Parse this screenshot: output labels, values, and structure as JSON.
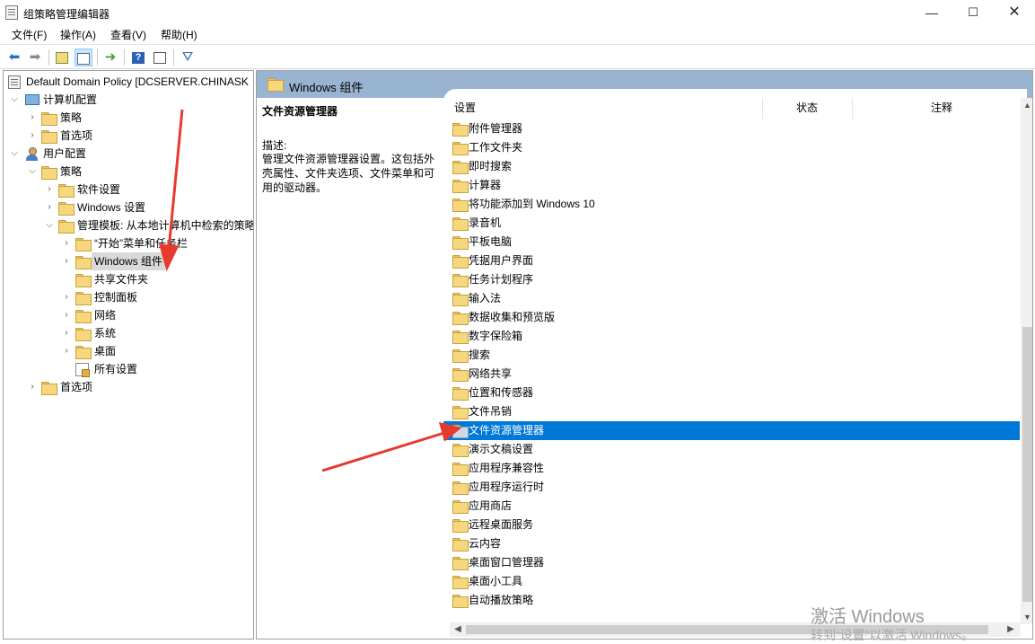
{
  "window": {
    "title": "组策略管理编辑器"
  },
  "menu": [
    "文件(F)",
    "操作(A)",
    "查看(V)",
    "帮助(H)"
  ],
  "tree": {
    "root": "Default Domain Policy [DCSERVER.CHINASK",
    "computer_config": "计算机配置",
    "cc_policies": "策略",
    "cc_preferences": "首选项",
    "user_config": "用户配置",
    "uc_policies": "策略",
    "software_settings": "软件设置",
    "windows_settings": "Windows 设置",
    "admin_templates": "管理模板: 从本地计算机中检索的策略",
    "start_menu": "“开始”菜单和任务栏",
    "windows_components": "Windows 组件",
    "shared_folders": "共享文件夹",
    "control_panel": "控制面板",
    "network": "网络",
    "system": "系统",
    "desktop": "桌面",
    "all_settings": "所有设置",
    "uc_preferences": "首选项"
  },
  "right": {
    "header_title": "Windows 组件",
    "desc_title": "文件资源管理器",
    "desc_label": "描述:",
    "desc_text": "管理文件资源管理器设置。这包括外壳属性、文件夹选项、文件菜单和可用的驱动器。",
    "columns": {
      "setting": "设置",
      "state": "状态",
      "comment": "注释"
    },
    "items": [
      "附件管理器",
      "工作文件夹",
      "即时搜索",
      "计算器",
      "将功能添加到 Windows 10",
      "录音机",
      "平板电脑",
      "凭据用户界面",
      "任务计划程序",
      "输入法",
      "数据收集和预览版",
      "数字保险箱",
      "搜索",
      "网络共享",
      "位置和传感器",
      "文件吊销",
      "文件资源管理器",
      "演示文稿设置",
      "应用程序兼容性",
      "应用程序运行时",
      "应用商店",
      "远程桌面服务",
      "云内容",
      "桌面窗口管理器",
      "桌面小工具",
      "自动播放策略"
    ],
    "selected_item": "文件资源管理器"
  },
  "watermark": {
    "line1": "激活 Windows",
    "line2": "转到“设置”以激活 Windows。"
  },
  "colors": {
    "accent": "#0078d7",
    "header": "#99b4d1",
    "arrow": "#e8392e"
  }
}
